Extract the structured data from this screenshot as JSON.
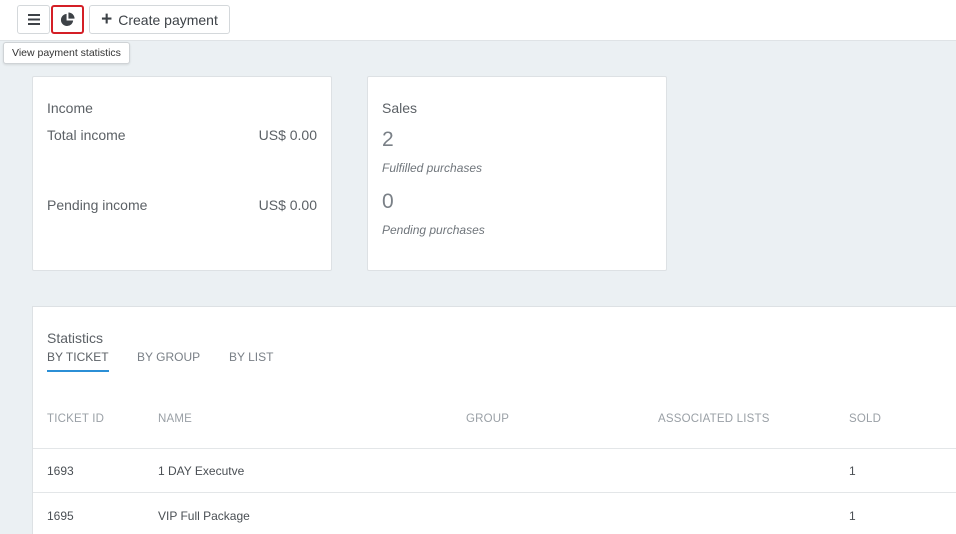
{
  "toolbar": {
    "create_label": "Create payment",
    "tooltip": "View payment statistics"
  },
  "income": {
    "title": "Income",
    "total_label": "Total income",
    "total_value": "US$ 0.00",
    "pending_label": "Pending income",
    "pending_value": "US$ 0.00"
  },
  "sales": {
    "title": "Sales",
    "fulfilled_count": "2",
    "fulfilled_label": "Fulfilled purchases",
    "pending_count": "0",
    "pending_label": "Pending purchases"
  },
  "statistics": {
    "title": "Statistics",
    "tabs": [
      "BY TICKET",
      "BY GROUP",
      "BY LIST"
    ],
    "active_tab": 0,
    "columns": [
      "TICKET ID",
      "NAME",
      "GROUP",
      "ASSOCIATED LISTS",
      "SOLD"
    ],
    "rows": [
      {
        "ticket_id": "1693",
        "name": "1 DAY Executve",
        "group": "",
        "lists": "",
        "sold": "1"
      },
      {
        "ticket_id": "1695",
        "name": "VIP Full Package",
        "group": "",
        "lists": "",
        "sold": "1"
      }
    ]
  },
  "colors": {
    "accent": "#2b8fd6",
    "highlight": "#d41f26",
    "background": "#ebf0f3"
  },
  "icons": {
    "menu": "hamburger-menu-icon",
    "stats": "pie-chart-icon",
    "create": "plus-icon"
  }
}
